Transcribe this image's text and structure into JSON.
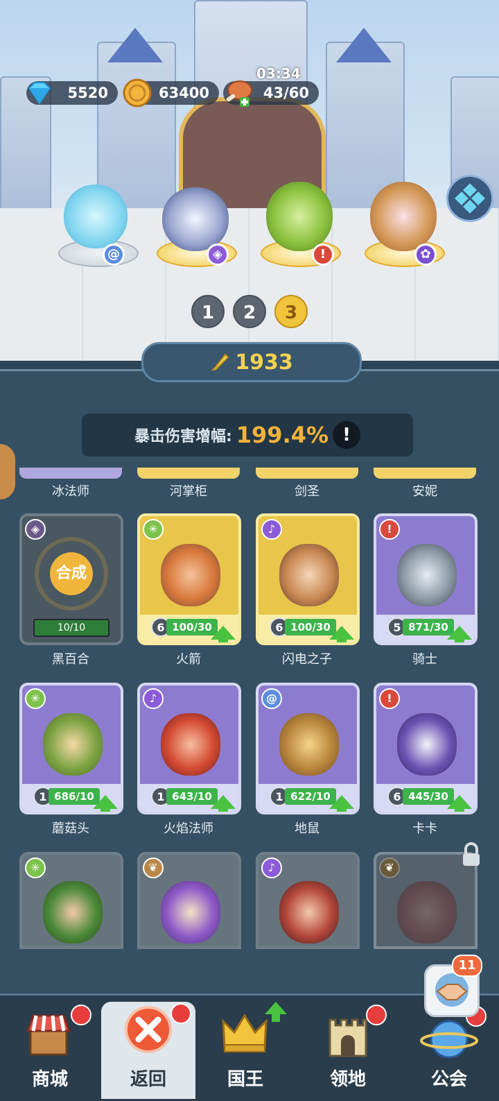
{
  "resources": {
    "gems": "5520",
    "coins": "63400",
    "stamina": "43/60",
    "stamina_timer": "03:34"
  },
  "team": {
    "pages": [
      "1",
      "2",
      "3"
    ],
    "active_page": "3"
  },
  "panel": {
    "power": "1933",
    "stat_label": "暴击伤害增幅:",
    "stat_value": "199.4%",
    "stat_info": "!",
    "partial_row": [
      "冰法师",
      "河掌柜",
      "剑圣",
      "安妮"
    ]
  },
  "heroes": [
    {
      "name": "黑百合",
      "style": "merge",
      "merge_label": "合成",
      "progress_text": "10/10",
      "progress": 1.0
    },
    {
      "name": "火箭",
      "style": "gold",
      "level": "6",
      "progress_text": "100/30",
      "progress": 1.0,
      "class_icon": "network-icon",
      "class_color": "#7cc24b"
    },
    {
      "name": "闪电之子",
      "style": "gold",
      "level": "6",
      "progress_text": "100/30",
      "progress": 1.0,
      "class_icon": "staff-icon",
      "class_color": "#8c5bd8"
    },
    {
      "name": "骑士",
      "style": "purple",
      "level": "5",
      "progress_text": "871/30",
      "progress": 1.0,
      "class_icon": "sword-icon",
      "class_color": "#d9493c"
    },
    {
      "name": "蘑菇头",
      "style": "purple",
      "level": "1",
      "progress_text": "686/10",
      "progress": 1.0,
      "class_icon": "network-icon",
      "class_color": "#7cc24b"
    },
    {
      "name": "火焰法师",
      "style": "purple",
      "level": "1",
      "progress_text": "643/10",
      "progress": 1.0,
      "class_icon": "staff-icon",
      "class_color": "#8c5bd8"
    },
    {
      "name": "地鼠",
      "style": "purple",
      "level": "1",
      "progress_text": "622/10",
      "progress": 1.0,
      "class_icon": "swirl-icon",
      "class_color": "#5b8de0"
    },
    {
      "name": "卡卡",
      "style": "purple",
      "level": "6",
      "progress_text": "445/30",
      "progress": 1.0,
      "class_icon": "sword-icon",
      "class_color": "#d9493c"
    }
  ],
  "nav": [
    {
      "label": "商城",
      "icon": "shop-icon",
      "dot": true
    },
    {
      "label": "返回",
      "icon": "close-icon",
      "dot": true,
      "active": true
    },
    {
      "label": "国王",
      "icon": "crown-icon",
      "dot": false,
      "arrow": true
    },
    {
      "label": "领地",
      "icon": "castle-icon",
      "dot": true
    },
    {
      "label": "公会",
      "icon": "planet-icon",
      "dot": true
    }
  ],
  "guild_handshake_badge": "11",
  "colors": {
    "accent_gold": "#f4b23c",
    "panel_bg": "#355063",
    "nav_dot": "#e73d3d",
    "upgrade_green": "#49c33f"
  }
}
